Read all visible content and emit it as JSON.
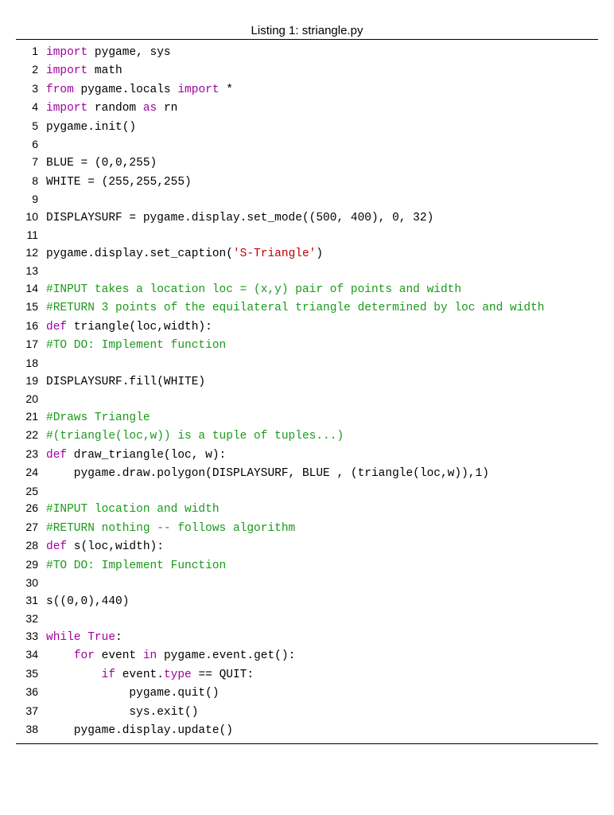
{
  "caption": "Listing 1: striangle.py",
  "lines": [
    {
      "n": 1,
      "tokens": [
        [
          "kw",
          "import"
        ],
        [
          "",
          " pygame, sys"
        ]
      ]
    },
    {
      "n": 2,
      "tokens": [
        [
          "kw",
          "import"
        ],
        [
          "",
          " math"
        ]
      ]
    },
    {
      "n": 3,
      "tokens": [
        [
          "kw",
          "from"
        ],
        [
          "",
          " pygame.locals "
        ],
        [
          "kw",
          "import"
        ],
        [
          "",
          " *"
        ]
      ]
    },
    {
      "n": 4,
      "tokens": [
        [
          "kw",
          "import"
        ],
        [
          "",
          " random "
        ],
        [
          "kw",
          "as"
        ],
        [
          "",
          " rn"
        ]
      ]
    },
    {
      "n": 5,
      "tokens": [
        [
          "",
          "pygame.init()"
        ]
      ]
    },
    {
      "n": 6,
      "tokens": [
        [
          "",
          ""
        ]
      ]
    },
    {
      "n": 7,
      "tokens": [
        [
          "",
          "BLUE = (0,0,255)"
        ]
      ]
    },
    {
      "n": 8,
      "tokens": [
        [
          "",
          "WHITE = (255,255,255)"
        ]
      ]
    },
    {
      "n": 9,
      "tokens": [
        [
          "",
          ""
        ]
      ]
    },
    {
      "n": 10,
      "tokens": [
        [
          "",
          "DISPLAYSURF = pygame.display.set_mode((500, 400), 0, 32)"
        ]
      ]
    },
    {
      "n": 11,
      "tokens": [
        [
          "",
          ""
        ]
      ]
    },
    {
      "n": 12,
      "tokens": [
        [
          "",
          "pygame.display.set_caption("
        ],
        [
          "str",
          "'S-Triangle'"
        ],
        [
          "",
          ")"
        ]
      ]
    },
    {
      "n": 13,
      "tokens": [
        [
          "",
          ""
        ]
      ]
    },
    {
      "n": 14,
      "tokens": [
        [
          "cm",
          "#INPUT takes a location loc = (x,y) pair of points and width"
        ]
      ]
    },
    {
      "n": 15,
      "tokens": [
        [
          "cm",
          "#RETURN 3 points of the equilateral triangle determined by loc and width"
        ]
      ]
    },
    {
      "n": 16,
      "tokens": [
        [
          "kw",
          "def"
        ],
        [
          "",
          " triangle(loc,width):"
        ]
      ]
    },
    {
      "n": 17,
      "tokens": [
        [
          "cm",
          "#TO DO: Implement function"
        ]
      ]
    },
    {
      "n": 18,
      "tokens": [
        [
          "",
          ""
        ]
      ]
    },
    {
      "n": 19,
      "tokens": [
        [
          "",
          "DISPLAYSURF.fill(WHITE)"
        ]
      ]
    },
    {
      "n": 20,
      "tokens": [
        [
          "",
          ""
        ]
      ]
    },
    {
      "n": 21,
      "tokens": [
        [
          "cm",
          "#Draws Triangle"
        ]
      ]
    },
    {
      "n": 22,
      "tokens": [
        [
          "cm",
          "#(triangle(loc,w)) is a tuple of tuples...)"
        ]
      ]
    },
    {
      "n": 23,
      "tokens": [
        [
          "kw",
          "def"
        ],
        [
          "",
          " draw_triangle(loc, w):"
        ]
      ]
    },
    {
      "n": 24,
      "tokens": [
        [
          "",
          "    pygame.draw.polygon(DISPLAYSURF, BLUE , (triangle(loc,w)),1)"
        ]
      ]
    },
    {
      "n": 25,
      "tokens": [
        [
          "",
          ""
        ]
      ]
    },
    {
      "n": 26,
      "tokens": [
        [
          "cm",
          "#INPUT location and width"
        ]
      ]
    },
    {
      "n": 27,
      "tokens": [
        [
          "cm",
          "#RETURN nothing -- follows algorithm"
        ]
      ]
    },
    {
      "n": 28,
      "tokens": [
        [
          "kw",
          "def"
        ],
        [
          "",
          " s(loc,width):"
        ]
      ]
    },
    {
      "n": 29,
      "tokens": [
        [
          "cm",
          "#TO DO: Implement Function"
        ]
      ]
    },
    {
      "n": 30,
      "tokens": [
        [
          "",
          ""
        ]
      ]
    },
    {
      "n": 31,
      "tokens": [
        [
          "",
          "s((0,0),440)"
        ]
      ]
    },
    {
      "n": 32,
      "tokens": [
        [
          "",
          ""
        ]
      ]
    },
    {
      "n": 33,
      "tokens": [
        [
          "kw",
          "while"
        ],
        [
          "",
          " "
        ],
        [
          "bi",
          "True"
        ],
        [
          "",
          ":"
        ]
      ]
    },
    {
      "n": 34,
      "tokens": [
        [
          "",
          "    "
        ],
        [
          "kw",
          "for"
        ],
        [
          "",
          " event "
        ],
        [
          "kw",
          "in"
        ],
        [
          "",
          " pygame.event.get():"
        ]
      ]
    },
    {
      "n": 35,
      "tokens": [
        [
          "",
          "        "
        ],
        [
          "kw",
          "if"
        ],
        [
          "",
          " event."
        ],
        [
          "bi",
          "type"
        ],
        [
          "",
          " == QUIT:"
        ]
      ]
    },
    {
      "n": 36,
      "tokens": [
        [
          "",
          "            pygame.quit()"
        ]
      ]
    },
    {
      "n": 37,
      "tokens": [
        [
          "",
          "            sys.exit()"
        ]
      ]
    },
    {
      "n": 38,
      "tokens": [
        [
          "",
          "    pygame.display.update()"
        ]
      ]
    }
  ]
}
